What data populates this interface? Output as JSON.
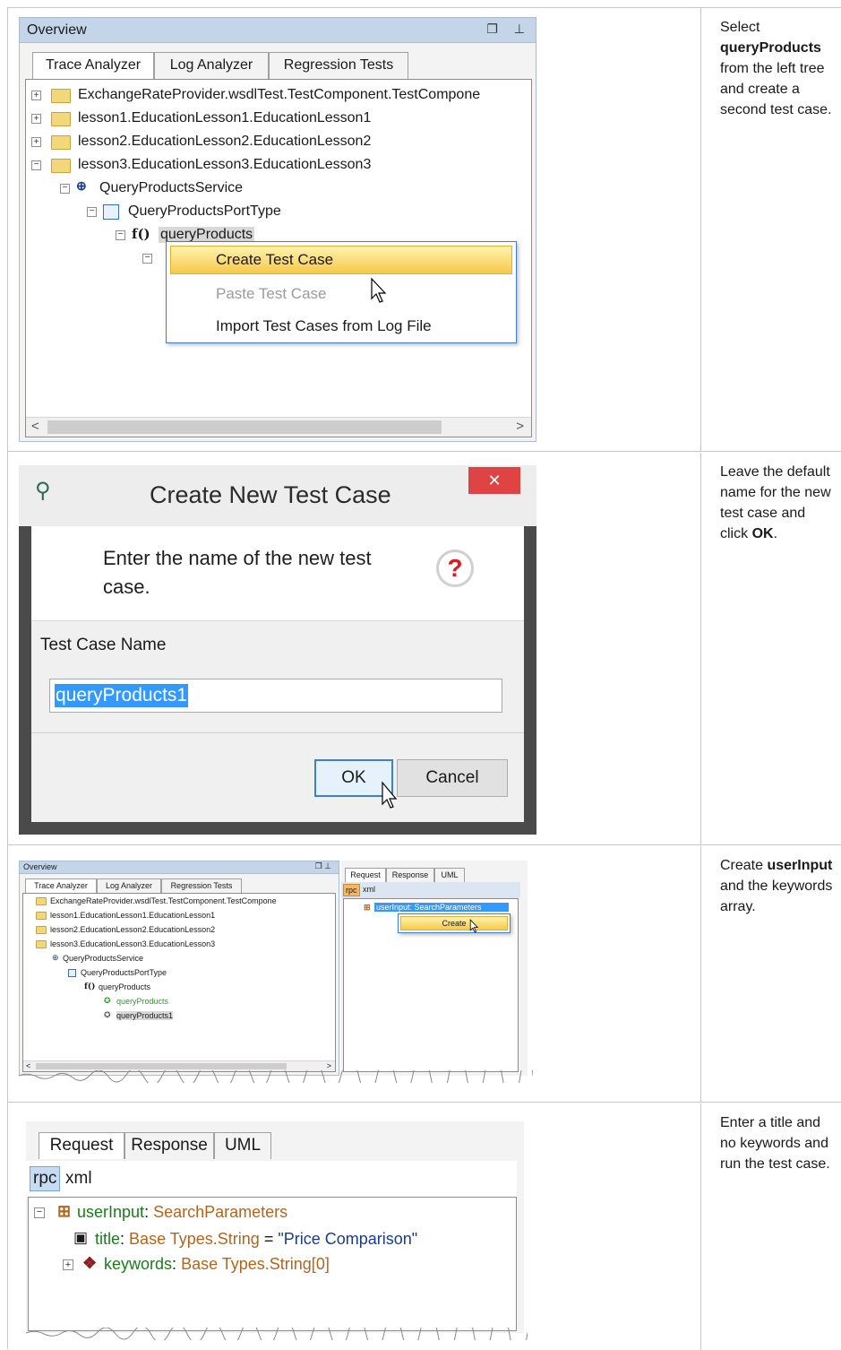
{
  "steps": [
    {
      "pre": "Select ",
      "bold": "queryProducts",
      "post": " from the left tree and create a second test case."
    },
    {
      "pre": "Leave the default name for the new test case and click ",
      "bold": "OK",
      "post": "."
    },
    {
      "pre": "Create ",
      "bold": "userInput",
      "post": " and the keywords array."
    },
    {
      "pre": "Enter a title and no keywords and run the test case.",
      "bold": "",
      "post": ""
    }
  ],
  "overview": {
    "title": "Overview",
    "tabs": [
      "Trace Analyzer",
      "Log Analyzer",
      "Regression Tests"
    ],
    "tree": [
      "ExchangeRateProvider.wsdlTest.TestComponent.TestCompone",
      "lesson1.EducationLesson1.EducationLesson1",
      "lesson2.EducationLesson2.EducationLesson2",
      "lesson3.EducationLesson3.EducationLesson3",
      "QueryProductsService",
      "QueryProductsPortType",
      "queryProducts"
    ],
    "context_menu": [
      "Create Test Case",
      "Paste Test Case",
      "Import Test Cases from Log File"
    ],
    "fn_glyph": "f()",
    "scroll_left": "<",
    "scroll_right": ">"
  },
  "dialog": {
    "title": "Create New Test Case",
    "message": "Enter the name of the new test case.",
    "label": "Test Case Name",
    "input_value": "queryProducts1",
    "ok": "OK",
    "cancel": "Cancel",
    "question_mark": "?",
    "close": "✕"
  },
  "step3": {
    "tree_extra": [
      "queryProducts",
      "queryProducts1"
    ],
    "tabs": [
      "Request",
      "Response",
      "UML"
    ],
    "modes": [
      "rpc",
      "xml"
    ],
    "node": "userInput: SearchParameters",
    "menu": "Create"
  },
  "request": {
    "tabs": [
      "Request",
      "Response",
      "UML"
    ],
    "modes": [
      "rpc",
      "xml"
    ],
    "root_name": "userInput",
    "root_type": "SearchParameters",
    "title_name": "title",
    "title_type": "Base Types.String",
    "title_eq": "=",
    "title_value": "\"Price Comparison\"",
    "keywords_name": "keywords",
    "keywords_type": "Base Types.String[0]",
    "sep": ":"
  }
}
